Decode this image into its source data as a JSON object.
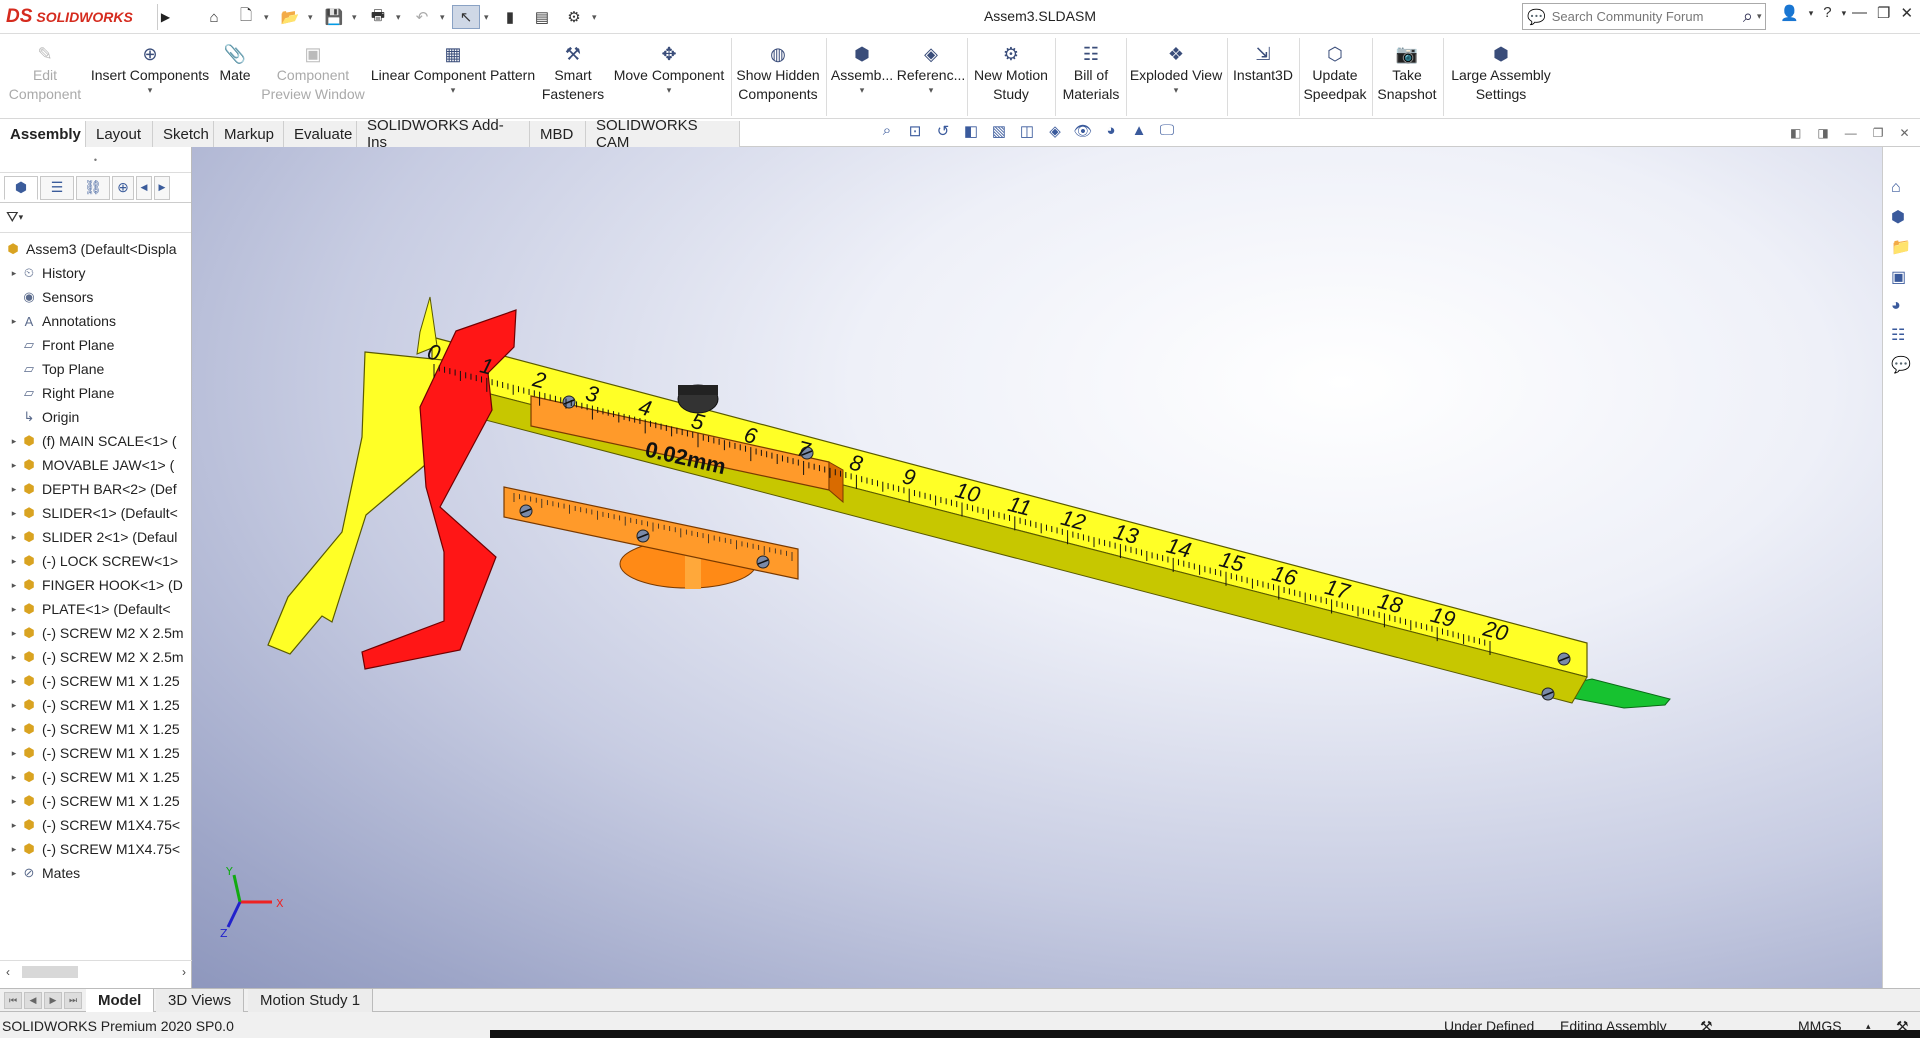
{
  "app": {
    "logo_ds": "DS",
    "logo_text": "SOLIDWORKS",
    "doc_title": "Assem3.SLDASM"
  },
  "search": {
    "placeholder": "Search Community Forum"
  },
  "ribbon": {
    "edit_component": [
      "Edit",
      "Component"
    ],
    "insert_components": "Insert Components",
    "mate": "Mate",
    "component_preview": [
      "Component",
      "Preview Window"
    ],
    "linear_pattern": "Linear Component Pattern",
    "smart_fasteners": [
      "Smart",
      "Fasteners"
    ],
    "move_component": "Move Component",
    "show_hidden": [
      "Show Hidden",
      "Components"
    ],
    "assembly_features": "Assemb...",
    "reference_geometry": "Referenc...",
    "new_motion_study": [
      "New Motion",
      "Study"
    ],
    "bill_of_materials": [
      "Bill of",
      "Materials"
    ],
    "exploded_view": "Exploded View",
    "instant3d": "Instant3D",
    "update_speedpak": [
      "Update",
      "Speedpak"
    ],
    "take_snapshot": [
      "Take",
      "Snapshot"
    ],
    "large_assembly": [
      "Large Assembly",
      "Settings"
    ]
  },
  "tabs": [
    "Assembly",
    "Layout",
    "Sketch",
    "Markup",
    "Evaluate",
    "SOLIDWORKS Add-Ins",
    "MBD",
    "SOLIDWORKS CAM"
  ],
  "tree": [
    {
      "label": "Assem3  (Default<Displa",
      "icon": "assembly-icon",
      "exp": false
    },
    {
      "label": "History",
      "icon": "history-icon",
      "exp": true
    },
    {
      "label": "Sensors",
      "icon": "sensor-icon",
      "exp": false
    },
    {
      "label": "Annotations",
      "icon": "annotation-icon",
      "exp": true
    },
    {
      "label": "Front Plane",
      "icon": "plane-icon",
      "exp": false
    },
    {
      "label": "Top Plane",
      "icon": "plane-icon",
      "exp": false
    },
    {
      "label": "Right Plane",
      "icon": "plane-icon",
      "exp": false
    },
    {
      "label": "Origin",
      "icon": "origin-icon",
      "exp": false
    },
    {
      "label": "(f) MAIN SCALE<1> (",
      "icon": "part-icon",
      "exp": true
    },
    {
      "label": "MOVABLE JAW<1> (",
      "icon": "part-icon",
      "exp": true
    },
    {
      "label": "DEPTH BAR<2> (Def",
      "icon": "part-icon",
      "exp": true
    },
    {
      "label": "SLIDER<1> (Default<",
      "icon": "part-icon",
      "exp": true
    },
    {
      "label": "SLIDER 2<1> (Defaul",
      "icon": "part-icon",
      "exp": true
    },
    {
      "label": "(-) LOCK SCREW<1>",
      "icon": "part-icon",
      "exp": true
    },
    {
      "label": "FINGER HOOK<1> (D",
      "icon": "part-icon",
      "exp": true
    },
    {
      "label": "PLATE<1> (Default<",
      "icon": "part-icon",
      "exp": true
    },
    {
      "label": "(-) SCREW M2 X 2.5m",
      "icon": "part-icon",
      "exp": true
    },
    {
      "label": "(-) SCREW M2 X 2.5m",
      "icon": "part-icon",
      "exp": true
    },
    {
      "label": "(-) SCREW M1 X 1.25",
      "icon": "part-icon",
      "exp": true
    },
    {
      "label": "(-) SCREW M1 X 1.25",
      "icon": "part-icon",
      "exp": true
    },
    {
      "label": "(-) SCREW M1 X 1.25",
      "icon": "part-icon",
      "exp": true
    },
    {
      "label": "(-) SCREW M1 X 1.25",
      "icon": "part-icon",
      "exp": true
    },
    {
      "label": "(-) SCREW M1 X 1.25",
      "icon": "part-icon",
      "exp": true
    },
    {
      "label": "(-) SCREW M1 X 1.25",
      "icon": "part-icon",
      "exp": true
    },
    {
      "label": "(-) SCREW M1X4.75<",
      "icon": "part-icon",
      "exp": true
    },
    {
      "label": "(-) SCREW M1X4.75<",
      "icon": "part-icon",
      "exp": true
    },
    {
      "label": "Mates",
      "icon": "mates-icon",
      "exp": true
    }
  ],
  "caliper": {
    "vernier_label": "0.02mm",
    "scale": [
      "0",
      "1",
      "2",
      "3",
      "4",
      "5",
      "6",
      "7",
      "8",
      "9",
      "10",
      "11",
      "12",
      "13",
      "14",
      "15",
      "16",
      "17",
      "18",
      "19",
      "20"
    ]
  },
  "triad": {
    "x": "X",
    "y": "Y",
    "z": "Z"
  },
  "bottom_tabs": [
    "Model",
    "3D Views",
    "Motion Study 1"
  ],
  "status": {
    "version": "SOLIDWORKS Premium 2020 SP0.0",
    "defined": "Under Defined",
    "mode": "Editing Assembly",
    "units": "MMGS"
  }
}
